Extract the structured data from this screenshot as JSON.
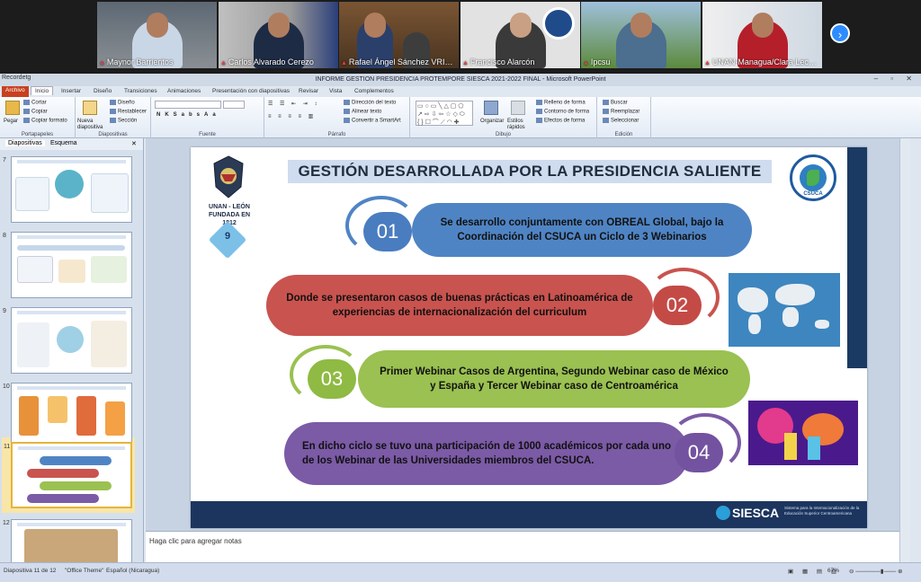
{
  "zoom": {
    "participants": [
      {
        "name": "Maynor Barrientos",
        "bg": "#6a7178",
        "shirt": "#c9d6e6"
      },
      {
        "name": "Carlos Alvarado Cerezo",
        "bg": "#b8b8b8",
        "shirt": "#1d2b44"
      },
      {
        "name": "Rafael Ángel Sánchez VRIC UNA...",
        "bg": "#6b4a2e",
        "shirt": "#2b3f6b"
      },
      {
        "name": "Francisco Alarcón",
        "bg": "#dcdcdc",
        "shirt": "#3a3a3a"
      },
      {
        "name": "Ipcsu",
        "bg": "#7da1c2",
        "shirt": "#4c6e8f"
      },
      {
        "name": "UNAN-Managua/Clara Lecha...",
        "bg": "#e8e8e8",
        "shirt": "#b51f2a"
      }
    ],
    "next_icon": "chevron-right-icon"
  },
  "app": {
    "title": "INFORME GESTION PRESIDENCIA PROTEMPORE SIESCA 2021-2022 FINAL - Microsoft PowerPoint",
    "quick_access": "Recordetg",
    "window_controls": "–  ▫  ✕"
  },
  "ribbon": {
    "tabs": [
      "Archivo",
      "Inicio",
      "Insertar",
      "Diseño",
      "Transiciones",
      "Animaciones",
      "Presentación con diapositivas",
      "Revisar",
      "Vista",
      "Complementos"
    ],
    "portapapeles": {
      "pegar": "Pegar",
      "cortar": "Cortar",
      "copiar": "Copiar",
      "copiar_formato": "Copiar formato",
      "label": "Portapapeles"
    },
    "diapositivas": {
      "nueva": "Nueva diapositiva",
      "diseno": "Diseño",
      "restablecer": "Restablecer",
      "seccion": "Sección",
      "label": "Diapositivas"
    },
    "fuente": {
      "label": "Fuente"
    },
    "parrafo": {
      "direccion": "Dirección del texto",
      "alinear": "Alinear texto",
      "smartart": "Convertir a SmartArt",
      "label": "Párrafo"
    },
    "dibujo": {
      "organizar": "Organizar",
      "estilos": "Estilos rápidos",
      "relleno": "Relleno de forma",
      "contorno": "Contorno de forma",
      "efectos": "Efectos de forma",
      "label": "Dibujo"
    },
    "edicion": {
      "buscar": "Buscar",
      "reemplazar": "Reemplazar",
      "seleccionar": "Seleccionar",
      "label": "Edición"
    }
  },
  "panes": {
    "tab_slides": "Diapositivas",
    "tab_outline": "Esquema"
  },
  "thumbnails": [
    {
      "num": "7"
    },
    {
      "num": "8"
    },
    {
      "num": "9"
    },
    {
      "num": "10"
    },
    {
      "num": "11"
    },
    {
      "num": "12"
    }
  ],
  "slide": {
    "title": "GESTIÓN DESARROLLADA POR LA PRESIDENCIA SALIENTE",
    "unan_text_1": "UNAN - LEÓN",
    "unan_text_2": "FUNDADA EN 1812",
    "page_badge": "9",
    "csuca_label": "CSUCA",
    "items": [
      {
        "num": "01",
        "text": "Se desarrollo conjuntamente con OBREAL Global, bajo la Coordinación del CSUCA un Ciclo de 3 Webinarios",
        "color": "#4f84c4",
        "numcolor": "#4a7cc0"
      },
      {
        "num": "02",
        "text": "Donde se presentaron casos de buenas prácticas en Latinoamérica de experiencias de internacionalización del curriculum",
        "color": "#c9534f",
        "numcolor": "#c44a46"
      },
      {
        "num": "03",
        "text": "Primer Webinar Casos de Argentina, Segundo Webinar caso de México y España y Tercer Webinar caso de Centroamérica",
        "color": "#9ac151",
        "numcolor": "#8fba43"
      },
      {
        "num": "04",
        "text": "En dicho ciclo se tuvo una participación de 1000 académicos por cada uno de los Webinar de las Universidades miembros del CSUCA.",
        "color": "#7b5aa6",
        "numcolor": "#7352a0"
      }
    ],
    "siesca_name": "SIESCA",
    "siesca_sub": "Sistema para la Internacionalización de la Educación Superior Centroamericana"
  },
  "notes_placeholder": "Haga clic para agregar notas",
  "status": {
    "slide_of": "Diapositiva 11 de 12",
    "theme": "\"Office Theme\"",
    "language": "Español (Nicaragua)",
    "zoom": "67%"
  }
}
